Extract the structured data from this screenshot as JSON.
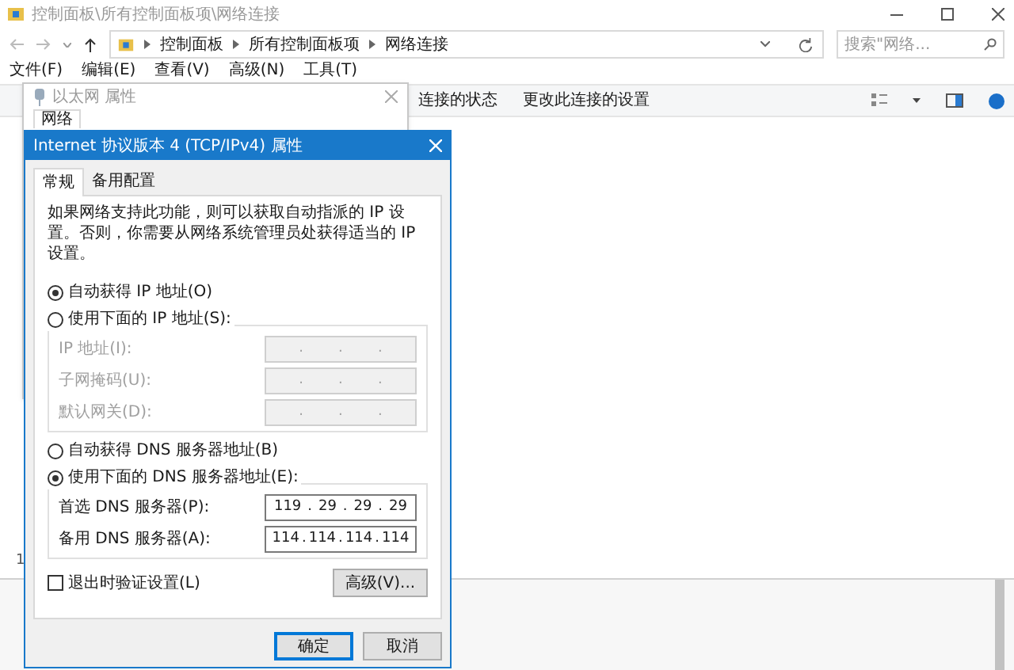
{
  "window": {
    "title": "控制面板\\所有控制面板项\\网络连接"
  },
  "address_bar": {
    "breadcrumbs": [
      "控制面板",
      "所有控制面板项",
      "网络连接"
    ],
    "search": {
      "placeholder": "搜索\"网络..."
    }
  },
  "menu": [
    "文件(F)",
    "编辑(E)",
    "查看(V)",
    "高级(N)",
    "工具(T)"
  ],
  "command_bar": [
    "连接的状态",
    "更改此连接的设置"
  ],
  "status_bar": {
    "count": "1"
  },
  "back_dialog": {
    "title": "以太网 属性",
    "tabs": [
      {
        "label": "网络",
        "selected": true
      }
    ]
  },
  "dialog": {
    "title": "Internet 协议版本 4 (TCP/IPv4) 属性",
    "tabs": [
      {
        "label": "常规",
        "selected": true
      },
      {
        "label": "备用配置",
        "selected": false
      }
    ],
    "intro": "如果网络支持此功能，则可以获取自动指派的 IP 设置。否则，你需要从网络系统管理员处获得适当的 IP 设置。",
    "ip_separator": ".",
    "ip_mode": [
      {
        "label": "自动获得 IP 地址(O)",
        "selected": true
      },
      {
        "label": "使用下面的 IP 地址(S):",
        "selected": false
      }
    ],
    "ip_fields": [
      {
        "label": "IP 地址(I):",
        "disabled": true
      },
      {
        "label": "子网掩码(U):",
        "disabled": true
      },
      {
        "label": "默认网关(D):",
        "disabled": true
      }
    ],
    "dns_mode": [
      {
        "label": "自动获得 DNS 服务器地址(B)",
        "selected": false
      },
      {
        "label": "使用下面的 DNS 服务器地址(E):",
        "selected": true
      }
    ],
    "dns_fields": [
      {
        "label": "首选 DNS 服务器(P):",
        "disabled": false,
        "octets": [
          "119",
          "29",
          "29",
          "29"
        ]
      },
      {
        "label": "备用 DNS 服务器(A):",
        "disabled": false,
        "octets": [
          "114",
          "114",
          "114",
          "114"
        ]
      }
    ],
    "validate": {
      "label": "退出时验证设置(L)",
      "checked": false
    },
    "advanced_button": "高级(V)...",
    "buttons": [
      {
        "label": "确定",
        "default": true
      },
      {
        "label": "取消",
        "default": false
      }
    ]
  }
}
